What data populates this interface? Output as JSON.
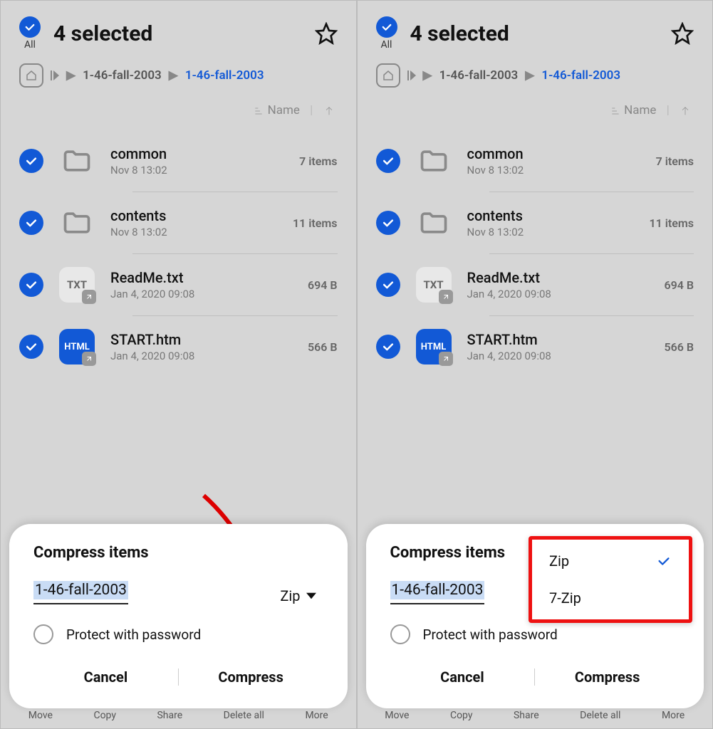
{
  "header": {
    "all_label": "All",
    "title": "4 selected"
  },
  "breadcrumb": {
    "items": [
      "1-46-fall-2003",
      "1-46-fall-2003"
    ]
  },
  "sort": {
    "label": "Name"
  },
  "files": [
    {
      "name": "common",
      "date": "Nov 8 13:02",
      "meta": "7 items",
      "type": "folder"
    },
    {
      "name": "contents",
      "date": "Nov 8 13:02",
      "meta": "11 items",
      "type": "folder"
    },
    {
      "name": "ReadMe.txt",
      "date": "Jan 4, 2020 09:08",
      "meta": "694 B",
      "type": "txt"
    },
    {
      "name": "START.htm",
      "date": "Jan 4, 2020 09:08",
      "meta": "566 B",
      "type": "html"
    }
  ],
  "sheet": {
    "title": "Compress items",
    "filename": "1-46-fall-2003",
    "format_label": "Zip",
    "protect_label": "Protect with password",
    "cancel": "Cancel",
    "confirm": "Compress"
  },
  "dropdown": {
    "options": [
      "Zip",
      "7-Zip"
    ],
    "selected": "Zip"
  },
  "toolbar": [
    "Move",
    "Copy",
    "Share",
    "Delete all",
    "More"
  ],
  "icon_labels": {
    "txt": "TXT",
    "html": "HTML"
  }
}
